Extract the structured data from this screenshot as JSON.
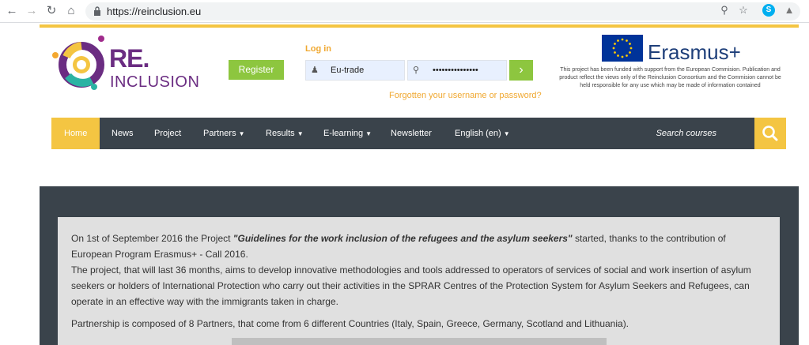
{
  "browser": {
    "url": "https://reinclusion.eu"
  },
  "logo": {
    "line1": "RE.",
    "line2": "INCLUSION"
  },
  "header": {
    "register_label": "Register",
    "login_label": "Log in",
    "username_value": "Eu-trade",
    "password_value": "•••••••••••••••",
    "forgot_link": "Forgotten your username or password?"
  },
  "erasmus": {
    "name": "Erasmus+",
    "note": "This project has been funded with support from the European Commision. Publication and product reflect the views only of the Reinclusion Consortium and the Commision cannot be held responsible for any use which may be made of information contained"
  },
  "nav": {
    "items": [
      {
        "label": "Home",
        "active": true
      },
      {
        "label": "News"
      },
      {
        "label": "Project"
      },
      {
        "label": "Partners",
        "dropdown": true
      },
      {
        "label": "Results",
        "dropdown": true
      },
      {
        "label": "E-learning",
        "dropdown": true
      },
      {
        "label": "Newsletter"
      },
      {
        "label": "English (en)",
        "dropdown": true
      }
    ],
    "search_label": "Search courses"
  },
  "content": {
    "p1_start": "On 1st of September 2016 the Project ",
    "p1_title": "\"Guidelines for the work inclusion of the refugees and the asylum seekers\"",
    "p1_end": " started, thanks to the contribution of European Program Erasmus+ - Call 2016.",
    "p2": "The project, that will last 36 months, aims to develop innovative methodologies and tools addressed to operators of services of social and work insertion of asylum seekers or holders of International Protection who carry out their activities in the SPRAR Centres of the Protection System for Asylum Seekers and Refugees, can operate in an effective way with the immigrants taken in charge.",
    "p3": "Partnership is composed of 8 Partners, that come from 6 different Countries (Italy, Spain, Greece, Germany, Scotland and Lithuania)."
  },
  "colors": {
    "accent_yellow": "#f4c542",
    "green": "#8dc63f",
    "nav_dark": "#3a434b",
    "brand_purple": "#6b2d82"
  }
}
